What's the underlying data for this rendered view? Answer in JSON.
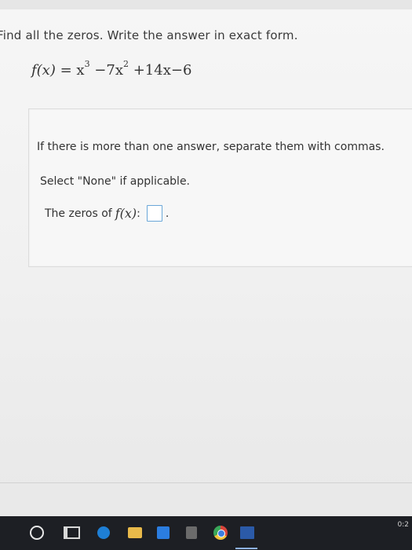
{
  "question": {
    "prompt": "Find all the zeros. Write the answer in exact form.",
    "function_name": "f(x)",
    "function_rhs_parts": {
      "lead": "x",
      "lead_exp": "3",
      "mid": "−7x",
      "mid_exp": "2",
      "tail": "+14x−6"
    }
  },
  "panel": {
    "instruction_multiple": "If there is more than one answer, separate them with commas.",
    "instruction_none": "Select \"None\" if applicable.",
    "answer_label": "The zeros of",
    "answer_fx": "f(x)",
    "answer_colon": ":",
    "answer_value": "",
    "answer_suffix": "."
  },
  "taskbar": {
    "icons": [
      "cortana-icon",
      "task-view-icon",
      "edge-icon",
      "file-explorer-icon",
      "store-icon",
      "notes-icon",
      "chrome-icon",
      "word-icon"
    ],
    "clock_fragment": "0:2"
  }
}
